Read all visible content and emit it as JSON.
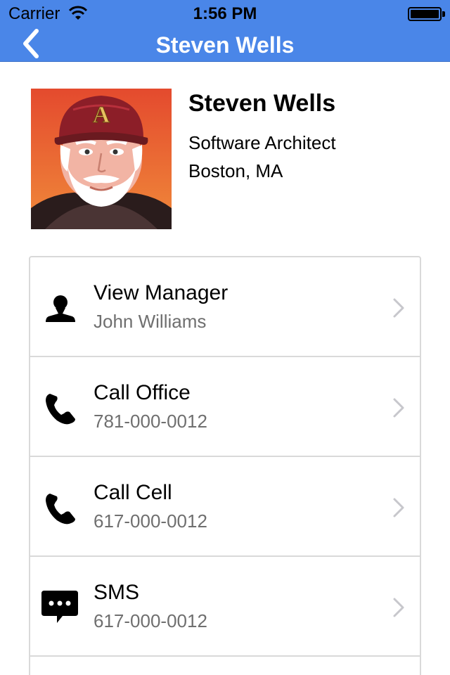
{
  "status_bar": {
    "carrier": "Carrier",
    "time": "1:56 PM",
    "wifi_icon": "wifi-icon",
    "battery_level": 1.0
  },
  "nav": {
    "title": "Steven Wells",
    "back_icon": "chevron-left-icon",
    "bar_color": "#4a86e8"
  },
  "profile": {
    "name": "Steven Wells",
    "title": "Software Architect",
    "location": "Boston, MA",
    "avatar_icon": "cartoon-avatar-portrait",
    "avatar_cap_letter": "A"
  },
  "actions": [
    {
      "icon": "person-icon",
      "label": "View Manager",
      "sub": "John Williams"
    },
    {
      "icon": "phone-icon",
      "label": "Call Office",
      "sub": "781-000-0012"
    },
    {
      "icon": "phone-icon",
      "label": "Call Cell",
      "sub": "617-000-0012"
    },
    {
      "icon": "sms-bubble-icon",
      "label": "SMS",
      "sub": "617-000-0012"
    }
  ],
  "colors": {
    "subtext": "#6f6f6f",
    "divider": "#d9d9d9",
    "chevron": "#c7c7cc"
  }
}
